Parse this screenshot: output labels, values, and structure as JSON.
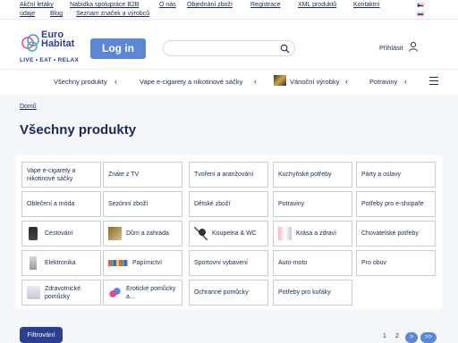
{
  "topbar": {
    "links": [
      "Akční letáky",
      "Nabídka spolupráce B2B",
      "O nás",
      "Objednání zboží",
      "Registrace",
      "XML produktů",
      "Kontaktní",
      "údaje",
      "Blog",
      "Seznam značek a výrobců"
    ]
  },
  "header": {
    "logo_line1": "Euro",
    "logo_line2": "Habitat",
    "logo_tagline": "LIVE • EAT • RELAX",
    "login_label": "Log in",
    "search_placeholder": "",
    "signin_label": "Přihlásit"
  },
  "nav": {
    "items": [
      "Všechny produkty",
      "Vape e-cigarety a nikotinové sáčky",
      "Vánoční výrobky",
      "Potraviny"
    ]
  },
  "breadcrumb": "Domů",
  "page_title": "Všechny produkty",
  "categories": [
    "Vape e-cigarety a nikotinové sáčky",
    "Znáte z TV",
    "Tvoření a aranžování",
    "Kuchyňské potřeby",
    "Párty a oslavy",
    "Oblečení a móda",
    "Sezónní zboží",
    "Dětské zboží",
    "Potraviny",
    "Potřeby pro e-shopaře",
    "Cestování",
    "Dům a zahrada",
    "Koupelna & WC",
    "Krása a zdraví",
    "Chovatelské potřeby",
    "Elektronika",
    "Papírnictví",
    "Sportovní vybavení",
    "Auto-moto",
    "Pro obuv",
    "Zdravotnické pomůcky",
    "Erotické pomůcky a...",
    "Ochranné pomůcky",
    "Potřeby pro kuřáky"
  ],
  "filter_label": "Filtrování",
  "pager": {
    "pages": [
      "1",
      "2"
    ],
    "next": ">",
    "last": ">>"
  },
  "colors": {
    "brand_navy": "#1b2a55",
    "accent_blue": "#5b87d6",
    "filter_navy": "#2a3f8f"
  }
}
